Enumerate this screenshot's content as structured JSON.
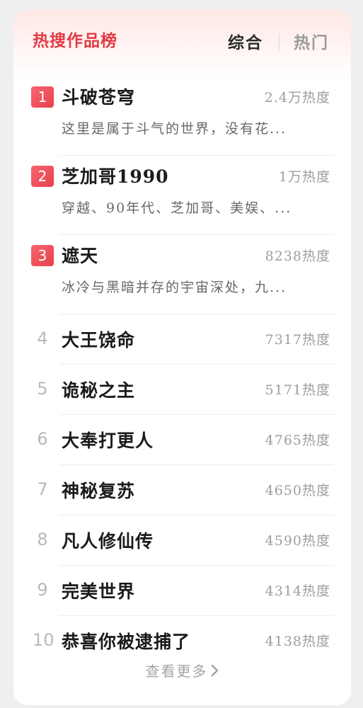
{
  "header": {
    "title": "热搜作品榜",
    "tabs": [
      {
        "label": "综合",
        "active": true
      },
      {
        "label": "热门",
        "active": false
      }
    ]
  },
  "colors": {
    "accent": "#e23b45",
    "badge": "#ef4f59",
    "rank_muted": "#b9b9b9"
  },
  "items": [
    {
      "rank": "1",
      "title": "斗破苍穹",
      "heat": "2.4万热度",
      "desc": "这里是属于斗气的世界，没有花..."
    },
    {
      "rank": "2",
      "title": "芝加哥1990",
      "heat": "1万热度",
      "desc": "穿越、90年代、芝加哥、美娱、..."
    },
    {
      "rank": "3",
      "title": "遮天",
      "heat": "8238热度",
      "desc": "冰冷与黑暗并存的宇宙深处，九..."
    },
    {
      "rank": "4",
      "title": "大王饶命",
      "heat": "7317热度"
    },
    {
      "rank": "5",
      "title": "诡秘之主",
      "heat": "5171热度"
    },
    {
      "rank": "6",
      "title": "大奉打更人",
      "heat": "4765热度"
    },
    {
      "rank": "7",
      "title": "神秘复苏",
      "heat": "4650热度"
    },
    {
      "rank": "8",
      "title": "凡人修仙传",
      "heat": "4590热度"
    },
    {
      "rank": "9",
      "title": "完美世界",
      "heat": "4314热度"
    },
    {
      "rank": "10",
      "title": "恭喜你被逮捕了",
      "heat": "4138热度"
    }
  ],
  "footer": {
    "more_label": "查看更多",
    "more_icon": "chevron-right-icon"
  }
}
